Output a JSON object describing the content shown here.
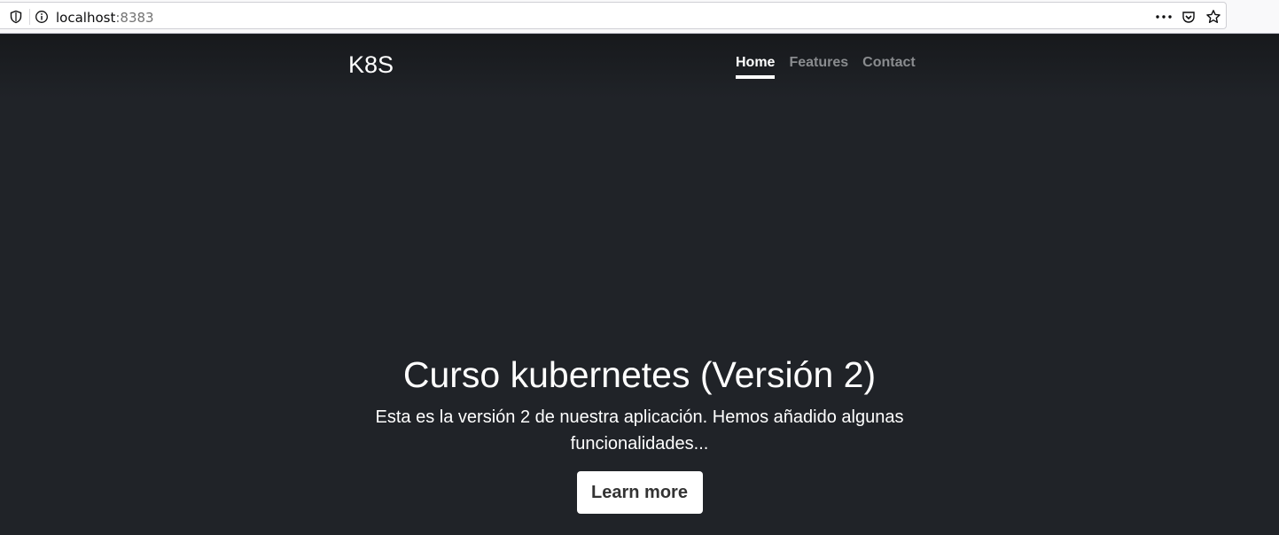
{
  "browser": {
    "url_host": "localhost",
    "url_port": ":8383",
    "icons": [
      "shield-icon",
      "info-icon",
      "more-icon",
      "pocket-icon",
      "star-icon"
    ]
  },
  "header": {
    "brand": "K8S",
    "nav": [
      {
        "label": "Home",
        "active": true
      },
      {
        "label": "Features",
        "active": false
      },
      {
        "label": "Contact",
        "active": false
      }
    ]
  },
  "hero": {
    "title": "Curso kubernetes (Versión 2)",
    "lead": "Esta es la versión 2 de nuestra aplicación. Hemos añadido algunas funcionalidades...",
    "button_label": "Learn more"
  },
  "colors": {
    "background": "#202328",
    "text": "#ffffff",
    "nav_inactive": "#8a8c8f"
  }
}
